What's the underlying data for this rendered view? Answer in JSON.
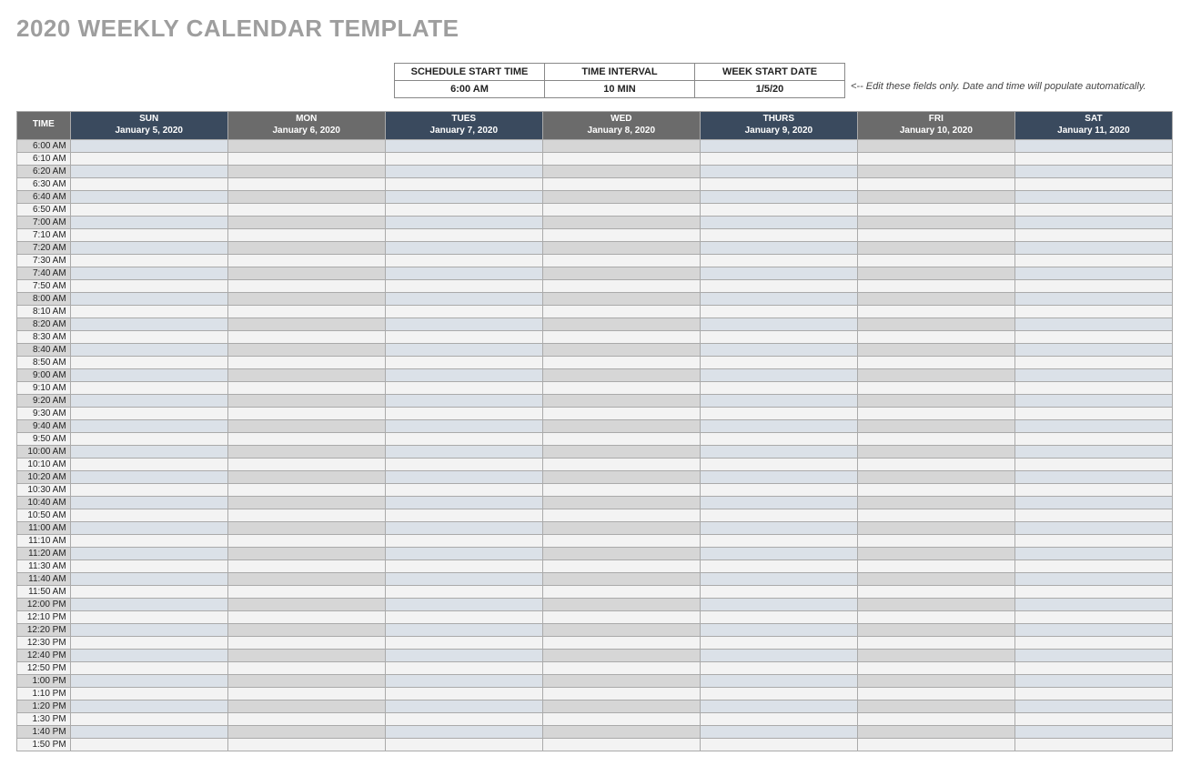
{
  "title": "2020 WEEKLY CALENDAR TEMPLATE",
  "settings": {
    "headers": {
      "start_time": "SCHEDULE START TIME",
      "interval": "TIME INTERVAL",
      "week_start": "WEEK START DATE"
    },
    "values": {
      "start_time": "6:00 AM",
      "interval": "10 MIN",
      "week_start": "1/5/20"
    },
    "hint": "<-- Edit these fields only. Date and time will populate automatically."
  },
  "calendar": {
    "time_header": "TIME",
    "days": [
      {
        "name": "SUN",
        "date": "January 5, 2020",
        "alt": false
      },
      {
        "name": "MON",
        "date": "January 6, 2020",
        "alt": true
      },
      {
        "name": "TUES",
        "date": "January 7, 2020",
        "alt": false
      },
      {
        "name": "WED",
        "date": "January 8, 2020",
        "alt": true
      },
      {
        "name": "THURS",
        "date": "January 9, 2020",
        "alt": false
      },
      {
        "name": "FRI",
        "date": "January 10, 2020",
        "alt": true
      },
      {
        "name": "SAT",
        "date": "January 11, 2020",
        "alt": false
      }
    ],
    "times": [
      "6:00 AM",
      "6:10 AM",
      "6:20 AM",
      "6:30 AM",
      "6:40 AM",
      "6:50 AM",
      "7:00 AM",
      "7:10 AM",
      "7:20 AM",
      "7:30 AM",
      "7:40 AM",
      "7:50 AM",
      "8:00 AM",
      "8:10 AM",
      "8:20 AM",
      "8:30 AM",
      "8:40 AM",
      "8:50 AM",
      "9:00 AM",
      "9:10 AM",
      "9:20 AM",
      "9:30 AM",
      "9:40 AM",
      "9:50 AM",
      "10:00 AM",
      "10:10 AM",
      "10:20 AM",
      "10:30 AM",
      "10:40 AM",
      "10:50 AM",
      "11:00 AM",
      "11:10 AM",
      "11:20 AM",
      "11:30 AM",
      "11:40 AM",
      "11:50 AM",
      "12:00 PM",
      "12:10 PM",
      "12:20 PM",
      "12:30 PM",
      "12:40 PM",
      "12:50 PM",
      "1:00 PM",
      "1:10 PM",
      "1:20 PM",
      "1:30 PM",
      "1:40 PM",
      "1:50 PM"
    ]
  }
}
